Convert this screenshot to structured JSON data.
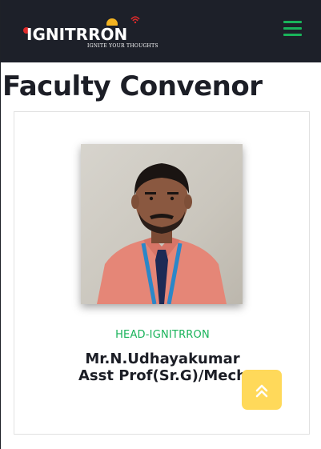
{
  "header": {
    "logo_text": "IGNITRRON",
    "logo_tagline": "IGNITE YOUR THOUGHTS"
  },
  "page": {
    "title": "Faculty Convenor"
  },
  "faculty": {
    "role": "HEAD-IGNITRRON",
    "name_line1": "Mr.N.Udhayakumar",
    "name_line2": "Asst Prof(Sr.G)/Mech"
  },
  "colors": {
    "header_bg": "#1d2029",
    "accent_green": "#19b35a",
    "back_to_top_yellow": "#ffd95a"
  },
  "icons": {
    "menu": "hamburger-icon",
    "back_to_top": "double-chevron-up-icon"
  }
}
